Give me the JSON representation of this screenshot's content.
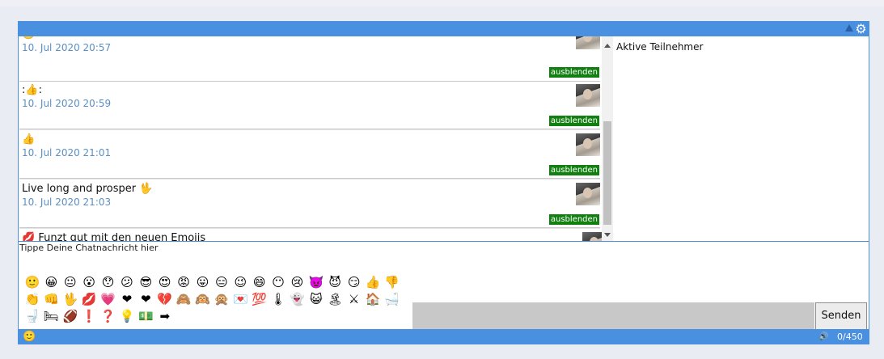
{
  "topbar": {
    "collapse_icon": "triangle-up-icon",
    "settings_icon": "gear-icon"
  },
  "messages": [
    {
      "text": "🙂",
      "time": "10. Jul 2020 20:57",
      "hide_label": "ausblenden"
    },
    {
      "text": ":👍:",
      "time": "10. Jul 2020 20:59",
      "hide_label": "ausblenden"
    },
    {
      "text": "👍",
      "time": "10. Jul 2020 21:01",
      "hide_label": "ausblenden"
    },
    {
      "text": "Live long and prosper 🖖",
      "time": "10. Jul 2020 21:03",
      "hide_label": "ausblenden"
    },
    {
      "text": "💋 Funzt gut mit den neuen Emojis",
      "time": "",
      "hide_label": ""
    }
  ],
  "participants": {
    "label": "Aktive Teilnehmer"
  },
  "input": {
    "placeholder": "Tippe Deine Chatnachricht hier"
  },
  "emoji_rows": [
    "🙂😀😐😮😯😕😎😍😡😛😑😉😄😶😢👿😈😏👍👎",
    "👏👊🖖💋💗❤️❤️💔🙈🙉🙊💌💯🌡️👻😺🏝️⚔️🏠🛁",
    "🚽🛏️🏈❗❓💡💵➡️"
  ],
  "send_label": "Senden",
  "bottombar": {
    "emoji_icon": "🙂",
    "speaker_icon": "🔊",
    "counter": "0/450"
  },
  "colors": {
    "accent": "#4a90e0",
    "hide_button": "#118011",
    "timestamp": "#5a8fc4"
  }
}
